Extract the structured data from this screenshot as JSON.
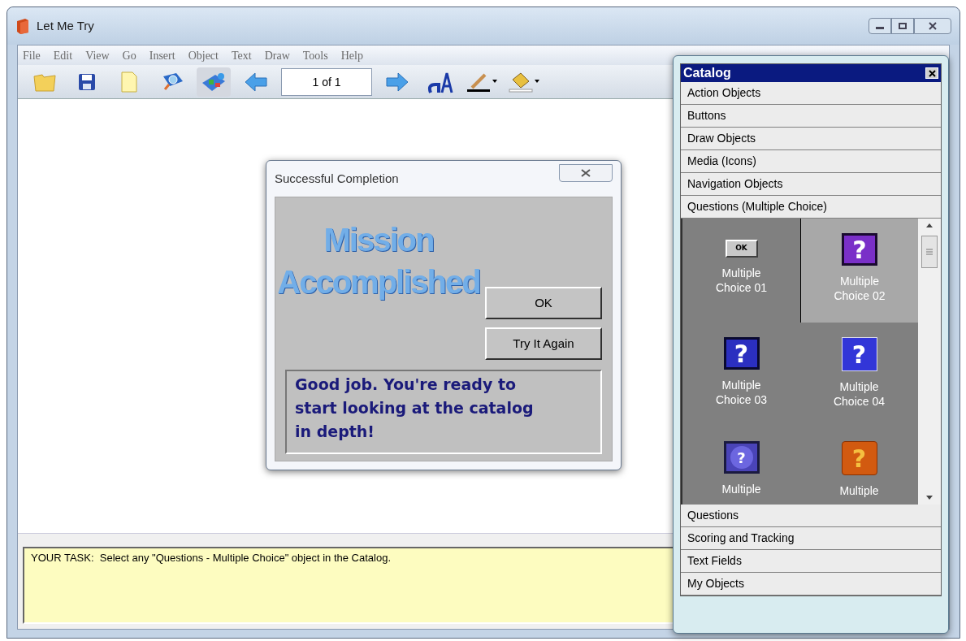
{
  "window": {
    "title": "Let Me Try"
  },
  "menu": [
    "File",
    "Edit",
    "View",
    "Go",
    "Insert",
    "Object",
    "Text",
    "Draw",
    "Tools",
    "Help"
  ],
  "toolbar": {
    "page_field": "1 of 1"
  },
  "dialog": {
    "title": "Successful Completion",
    "banner": [
      "Mission",
      "Accomplished"
    ],
    "buttons": [
      "OK",
      "Try It Again"
    ],
    "message": "Good job. You're ready to start looking at the catalog in depth!"
  },
  "task": "YOUR TASK:  Select any \"Questions - Multiple Choice\" object in the Catalog.",
  "catalog": {
    "title": "Catalog",
    "categories": [
      "Action Objects",
      "Buttons",
      "Draw Objects",
      "Media (Icons)",
      "Navigation Objects"
    ],
    "open_category": {
      "label": "Questions (Multiple Choice)",
      "items": [
        {
          "kind": "ok",
          "icon_text": "OK",
          "label": "Multiple Choice 01",
          "selected": false
        },
        {
          "kind": "purple",
          "icon_text": "?",
          "label": "Multiple Choice 02",
          "selected": true
        },
        {
          "kind": "navy",
          "icon_text": "?",
          "label": "Multiple Choice 03",
          "selected": false
        },
        {
          "kind": "blue",
          "icon_text": "?",
          "label": "Multiple Choice 04",
          "selected": false
        },
        {
          "kind": "circle",
          "icon_text": "?",
          "label": "Multiple",
          "selected": false
        },
        {
          "kind": "orange",
          "icon_text": "?",
          "label": "Multiple",
          "selected": false
        }
      ]
    },
    "more_categories": [
      "Questions",
      "Scoring and Tracking",
      "Text Fields",
      "My Objects"
    ]
  }
}
